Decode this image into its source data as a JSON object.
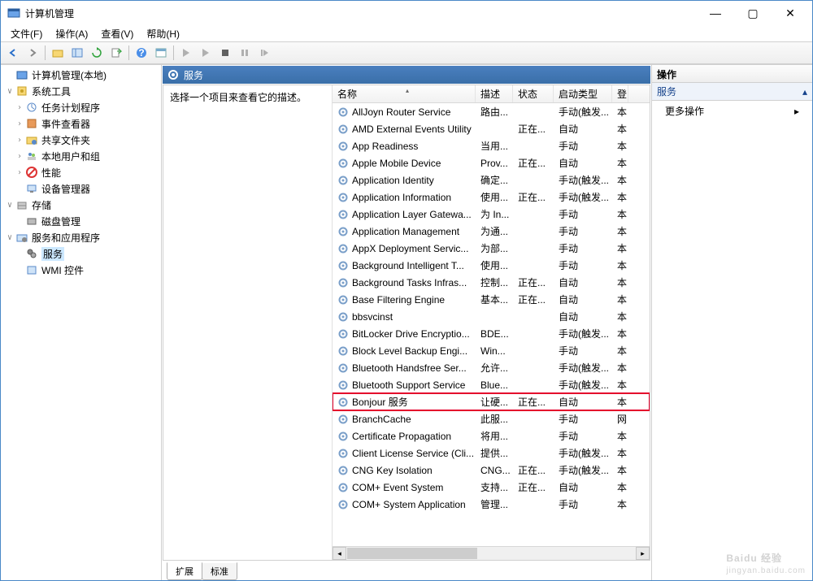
{
  "window": {
    "title": "计算机管理"
  },
  "menu": {
    "file": "文件(F)",
    "action": "操作(A)",
    "view": "查看(V)",
    "help": "帮助(H)"
  },
  "tree": {
    "root": "计算机管理(本地)",
    "sys_tools": "系统工具",
    "task_sched": "任务计划程序",
    "event_viewer": "事件查看器",
    "shared": "共享文件夹",
    "local_users": "本地用户和组",
    "perf": "性能",
    "device_mgr": "设备管理器",
    "storage": "存储",
    "disk_mgmt": "磁盘管理",
    "services_apps": "服务和应用程序",
    "services": "服务",
    "wmi": "WMI 控件"
  },
  "center": {
    "header": "服务",
    "hint": "选择一个项目来查看它的描述。",
    "columns": {
      "name": "名称",
      "desc": "描述",
      "status": "状态",
      "startup": "启动类型",
      "logon": "登"
    },
    "tabs": {
      "extended": "扩展",
      "standard": "标准"
    }
  },
  "services": [
    {
      "name": "AllJoyn Router Service",
      "desc": "路由...",
      "status": "",
      "startup": "手动(触发...",
      "logon": "本"
    },
    {
      "name": "AMD External Events Utility",
      "desc": "",
      "status": "正在...",
      "startup": "自动",
      "logon": "本"
    },
    {
      "name": "App Readiness",
      "desc": "当用...",
      "status": "",
      "startup": "手动",
      "logon": "本"
    },
    {
      "name": "Apple Mobile Device",
      "desc": "Prov...",
      "status": "正在...",
      "startup": "自动",
      "logon": "本"
    },
    {
      "name": "Application Identity",
      "desc": "确定...",
      "status": "",
      "startup": "手动(触发...",
      "logon": "本"
    },
    {
      "name": "Application Information",
      "desc": "使用...",
      "status": "正在...",
      "startup": "手动(触发...",
      "logon": "本"
    },
    {
      "name": "Application Layer Gatewa...",
      "desc": "为 In...",
      "status": "",
      "startup": "手动",
      "logon": "本"
    },
    {
      "name": "Application Management",
      "desc": "为通...",
      "status": "",
      "startup": "手动",
      "logon": "本"
    },
    {
      "name": "AppX Deployment Servic...",
      "desc": "为部...",
      "status": "",
      "startup": "手动",
      "logon": "本"
    },
    {
      "name": "Background Intelligent T...",
      "desc": "使用...",
      "status": "",
      "startup": "手动",
      "logon": "本"
    },
    {
      "name": "Background Tasks Infras...",
      "desc": "控制...",
      "status": "正在...",
      "startup": "自动",
      "logon": "本"
    },
    {
      "name": "Base Filtering Engine",
      "desc": "基本...",
      "status": "正在...",
      "startup": "自动",
      "logon": "本"
    },
    {
      "name": "bbsvcinst",
      "desc": "",
      "status": "",
      "startup": "自动",
      "logon": "本"
    },
    {
      "name": "BitLocker Drive Encryptio...",
      "desc": "BDE...",
      "status": "",
      "startup": "手动(触发...",
      "logon": "本"
    },
    {
      "name": "Block Level Backup Engi...",
      "desc": "Win...",
      "status": "",
      "startup": "手动",
      "logon": "本"
    },
    {
      "name": "Bluetooth Handsfree Ser...",
      "desc": "允许...",
      "status": "",
      "startup": "手动(触发...",
      "logon": "本"
    },
    {
      "name": "Bluetooth Support Service",
      "desc": "Blue...",
      "status": "",
      "startup": "手动(触发...",
      "logon": "本"
    },
    {
      "name": "Bonjour 服务",
      "desc": "让硬...",
      "status": "正在...",
      "startup": "自动",
      "logon": "本",
      "hl": true
    },
    {
      "name": "BranchCache",
      "desc": "此服...",
      "status": "",
      "startup": "手动",
      "logon": "网"
    },
    {
      "name": "Certificate Propagation",
      "desc": "将用...",
      "status": "",
      "startup": "手动",
      "logon": "本"
    },
    {
      "name": "Client License Service (Cli...",
      "desc": "提供...",
      "status": "",
      "startup": "手动(触发...",
      "logon": "本"
    },
    {
      "name": "CNG Key Isolation",
      "desc": "CNG...",
      "status": "正在...",
      "startup": "手动(触发...",
      "logon": "本"
    },
    {
      "name": "COM+ Event System",
      "desc": "支持...",
      "status": "正在...",
      "startup": "自动",
      "logon": "本"
    },
    {
      "name": "COM+ System Application",
      "desc": "管理...",
      "status": "",
      "startup": "手动",
      "logon": "本"
    }
  ],
  "actions": {
    "header": "操作",
    "sub": "服务",
    "more": "更多操作"
  },
  "watermark": {
    "brand": "Baidu 经验",
    "url": "jingyan.baidu.com"
  }
}
